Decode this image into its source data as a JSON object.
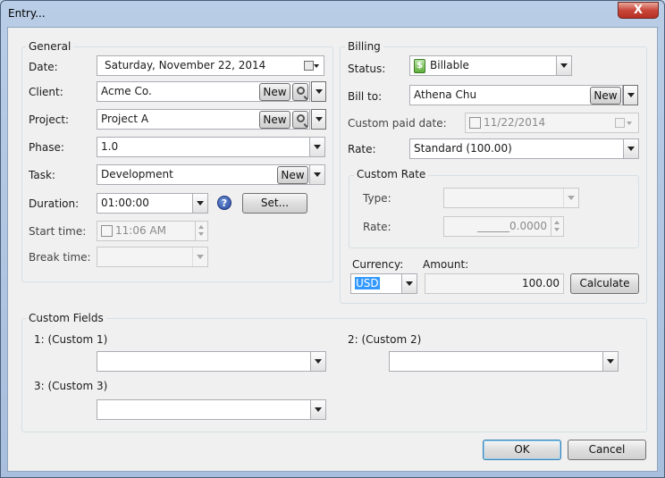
{
  "window": {
    "title": "Entry...",
    "close_glyph": "X"
  },
  "general": {
    "title": "General",
    "date": {
      "label": "Date:",
      "weekday": "Saturday",
      "value": ", November 22, 2014"
    },
    "client": {
      "label": "Client:",
      "value": "Acme Co.",
      "new_label": "New"
    },
    "project": {
      "label": "Project:",
      "value": "Project A",
      "new_label": "New"
    },
    "phase": {
      "label": "Phase:",
      "value": "1.0"
    },
    "task": {
      "label": "Task:",
      "value": "Development",
      "new_label": "New"
    },
    "duration": {
      "label": "Duration:",
      "value": "01:00:00",
      "help": "?",
      "set_label": "Set..."
    },
    "start_time": {
      "label": "Start time:",
      "value": "11:06 AM"
    },
    "break_time": {
      "label": "Break time:",
      "value": ""
    }
  },
  "billing": {
    "title": "Billing",
    "status": {
      "label": "Status:",
      "value": "Billable",
      "icon_glyph": "$"
    },
    "bill_to": {
      "label": "Bill to:",
      "value": "Athena Chu",
      "new_label": "New"
    },
    "custom_paid_date": {
      "label": "Custom paid date:",
      "value": "11/22/2014"
    },
    "rate": {
      "label": "Rate:",
      "value": "Standard (100.00)"
    },
    "custom_rate": {
      "title": "Custom Rate",
      "type_label": "Type:",
      "type_value": "",
      "rate_label": "Rate:",
      "rate_value": "______0.0000"
    },
    "currency": {
      "label": "Currency:",
      "value": "USD"
    },
    "amount": {
      "label": "Amount:",
      "value": "100.00"
    },
    "calculate_label": "Calculate"
  },
  "custom_fields": {
    "title": "Custom Fields",
    "field1": {
      "label": "1: (Custom 1)",
      "value": ""
    },
    "field2": {
      "label": "2: (Custom 2)",
      "value": ""
    },
    "field3": {
      "label": "3: (Custom 3)",
      "value": ""
    }
  },
  "footer": {
    "ok_label": "OK",
    "cancel_label": "Cancel"
  },
  "colors": {
    "accent": "#3399ff",
    "title_bar": "#b9cde6",
    "close_button": "#c9463a"
  }
}
